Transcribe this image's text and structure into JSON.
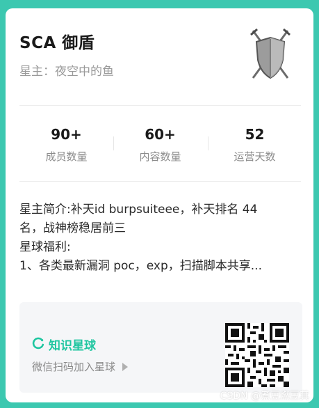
{
  "card": {
    "title": "SCA 御盾",
    "owner": "星主：夜空中的鱼",
    "stats": [
      {
        "value": "90+",
        "label": "成员数量"
      },
      {
        "value": "60+",
        "label": "内容数量"
      },
      {
        "value": "52",
        "label": "运营天数"
      }
    ],
    "description": [
      "星主简介:补天id   burpsuiteee，补天排名 44",
      "名，战神榜稳居前三",
      "星球福利:",
      "1、各类最新漏洞 poc，exp，扫描脚本共享..."
    ],
    "footer": {
      "brand": "知识星球",
      "join_text": "微信扫码加入星球"
    }
  },
  "watermark": "CSDN @煮豆燃豆萁",
  "icons": {
    "logo": "shield-swords-icon",
    "brand": "zsxq-logo-icon",
    "arrow": "play-triangle-icon",
    "qr": "qr-code"
  },
  "colors": {
    "background": "#3cc8b0",
    "brand": "#1fc6a0"
  }
}
